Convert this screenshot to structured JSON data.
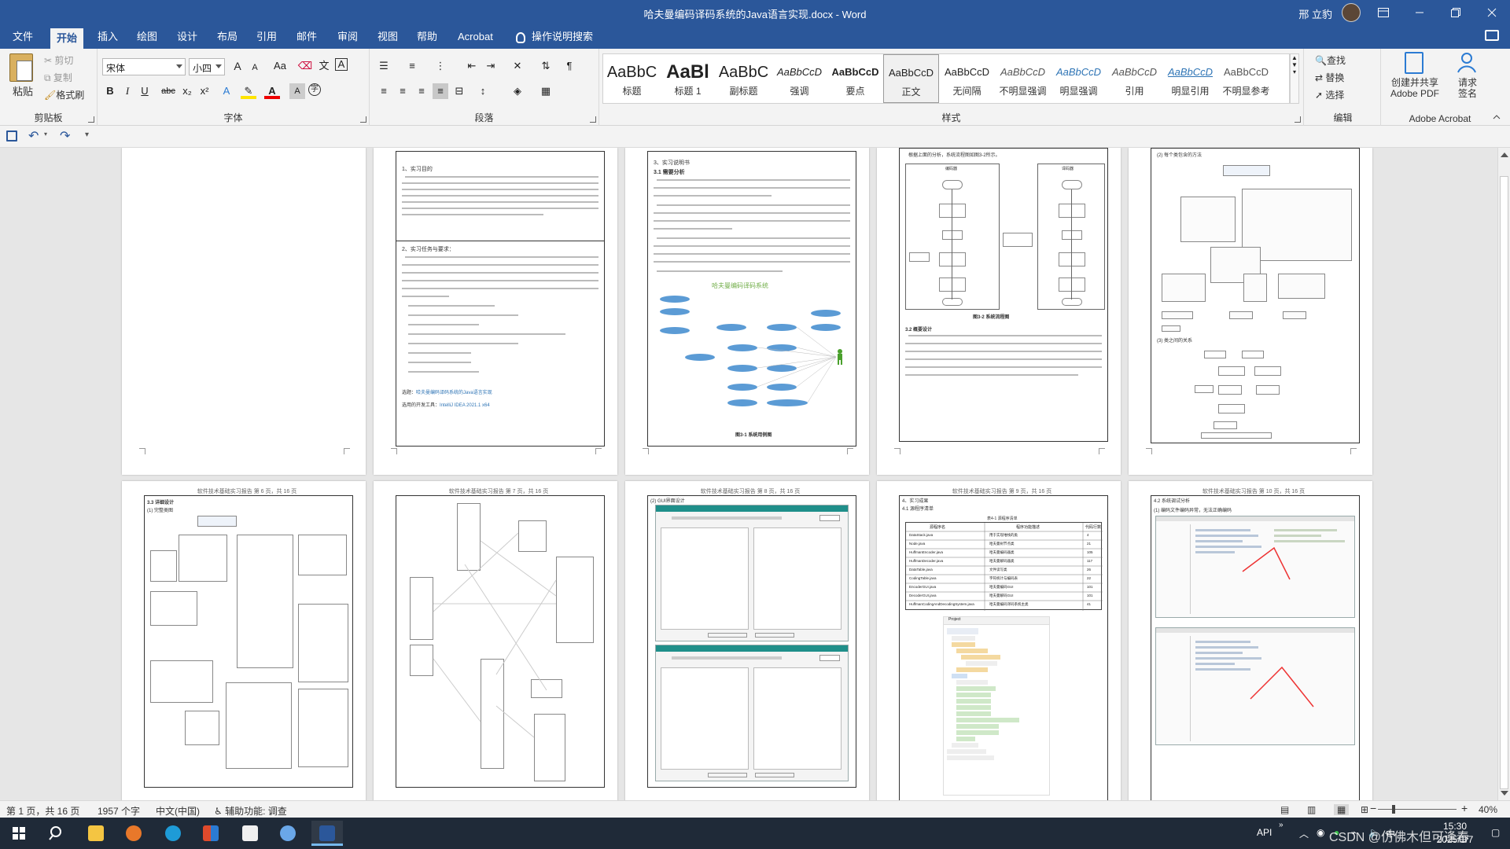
{
  "titlebar": {
    "document_title": "哈夫曼编码译码系统的Java语言实现.docx - Word",
    "user_name": "邢 立豹",
    "ribbon_display_icon": "ribbon-display-icon",
    "minimize_icon": "minimize-icon",
    "restore_icon": "restore-icon",
    "close_icon": "close-icon"
  },
  "tabs": [
    "文件",
    "开始",
    "插入",
    "绘图",
    "设计",
    "布局",
    "引用",
    "邮件",
    "审阅",
    "视图",
    "帮助",
    "Acrobat"
  ],
  "active_tab": "开始",
  "tell_me": "操作说明搜索",
  "clipboard": {
    "paste": "粘贴",
    "cut": "剪切",
    "copy": "复制",
    "format_painter": "格式刷",
    "label": "剪贴板"
  },
  "font": {
    "font_name": "宋体",
    "font_size": "小四",
    "grow": "A",
    "shrink": "A",
    "change_case": "Aa",
    "bold": "B",
    "italic": "I",
    "underline": "U",
    "strikethrough": "abc",
    "subscript": "x₂",
    "superscript": "x²",
    "label": "字体"
  },
  "paragraph": {
    "label": "段落"
  },
  "styles": {
    "label": "样式",
    "items": [
      {
        "sample": "AaBbC",
        "name": "标题"
      },
      {
        "sample": "AaBl",
        "name": "标题 1"
      },
      {
        "sample": "AaBbC",
        "name": "副标题"
      },
      {
        "sample": "AaBbCcD",
        "name": "强调"
      },
      {
        "sample": "AaBbCcD",
        "name": "要点"
      },
      {
        "sample": "AaBbCcD",
        "name": "正文"
      },
      {
        "sample": "AaBbCcD",
        "name": "无间隔"
      },
      {
        "sample": "AaBbCcD",
        "name": "不明显强调"
      },
      {
        "sample": "AaBbCcD",
        "name": "明显强调"
      },
      {
        "sample": "AaBbCcD",
        "name": "引用"
      },
      {
        "sample": "AaBbCcD",
        "name": "明显引用"
      },
      {
        "sample": "AaBbCcD",
        "name": "不明显参考"
      }
    ],
    "selected": "正文"
  },
  "editing": {
    "find": "查找",
    "replace": "替换",
    "select": "选择",
    "label": "编辑"
  },
  "adobe": {
    "create_share": "创建并共享",
    "create_share_2": "Adobe PDF",
    "request_sign": "请求",
    "request_sign_2": "签名",
    "label": "Adobe Acrobat"
  },
  "pages": {
    "p2": {
      "s1": "1、实习目的",
      "s2": "2、实习任务与要求：",
      "topic_label": "选题：",
      "topic": "哈夫曼编码译码系统的Java语言实现",
      "tool_label": "选用的开发工具：",
      "tool": "IntelliJ IDEA 2021.1 x64"
    },
    "p3": {
      "s": "3、实习说明书",
      "s1": "3.1 需要分析",
      "diagram_title": "哈夫曼编码译码系统",
      "fig": "图3-1 系统用例图"
    },
    "p4": {
      "intro": "根据上面的分析，系统流程图如图3-2所示。",
      "lane1": "编码器",
      "lane2": "译码器",
      "fig": "图3-2 系统流程图",
      "s": "3.2 概要设计"
    },
    "p5": {
      "s1": "(2) 每个类包含的方法",
      "s2": "(3) 类之间的关系"
    },
    "p6": {
      "header": "软件技术基础实习报告  第 6 页，共 16 页",
      "s": "3.3 详细设计",
      "s1": "(1) 完整类图"
    },
    "p7": {
      "header": "软件技术基础实习报告  第 7 页，共 16 页"
    },
    "p8": {
      "header": "软件技术基础实习报告  第 8 页，共 16 页",
      "s": "(2) GUI界面设计"
    },
    "p9": {
      "header": "软件技术基础实习报告  第 9 页，共 16 页",
      "s": "4、实习成果",
      "s1": "4.1 源程序清单",
      "tcap": "表4-1 源程序清单",
      "cols": [
        "源程序名",
        "程序功能描述",
        "代码行数"
      ],
      "rows": [
        [
          "DataStack.java",
          "用于实现堆栈的类",
          "4"
        ],
        [
          "Node.java",
          "哈夫曼树节点类",
          "21"
        ],
        [
          "HuffmanEncoder.java",
          "哈夫曼编码器类",
          "105"
        ],
        [
          "HuffmanDecoder.java",
          "哈夫曼解码器类",
          "117"
        ],
        [
          "DataTable.java",
          "文件读写类",
          "26"
        ],
        [
          "CodingTable.java",
          "字符统计与编码表",
          "22"
        ],
        [
          "EncoderGUI.java",
          "哈夫曼编码GUI",
          "101"
        ],
        [
          "DecoderGUI.java",
          "哈夫曼解码GUI",
          "101"
        ],
        [
          "HuffmanCodingAndDecodingSystem.java",
          "哈夫曼编码译码系统主类",
          "41"
        ]
      ],
      "tree": [
        "Project",
        "project",
        ".idea",
        "out",
        "artifacts",
        "project_jar",
        "project.jar",
        "production",
        "src",
        "META-INF",
        "CodingTable",
        "DataStack",
        "DataTable",
        "DecoderGUI",
        "EncoderGUI",
        "HuffmanCodingAndDecodingSystem",
        "HuffmanDecoder",
        "HuffmanEncoder",
        "Node",
        "project.iml",
        "External Libraries",
        "Scratches and Consoles"
      ]
    },
    "p10": {
      "header": "软件技术基础实习报告  第 10 页，共 16 页",
      "s": "4.2 系统调试分析",
      "s1": "(1) 编码文件编码异常，无法正确编码"
    }
  },
  "status": {
    "page": "第 1 页，共 16 页",
    "words": "1957 个字",
    "language": "中文(中国)",
    "accessibility": "辅助功能: 调查",
    "zoom": "40%"
  },
  "taskbar": {
    "tray_label": "API",
    "ime": "中",
    "time": "15:30",
    "date": "2025/1/7",
    "watermark": "CSDN @仿佛木但可逢春"
  },
  "colors": {
    "word_blue": "#2b579a",
    "accent_blue": "#5b9bd5",
    "taskbar": "#1f2a38"
  }
}
